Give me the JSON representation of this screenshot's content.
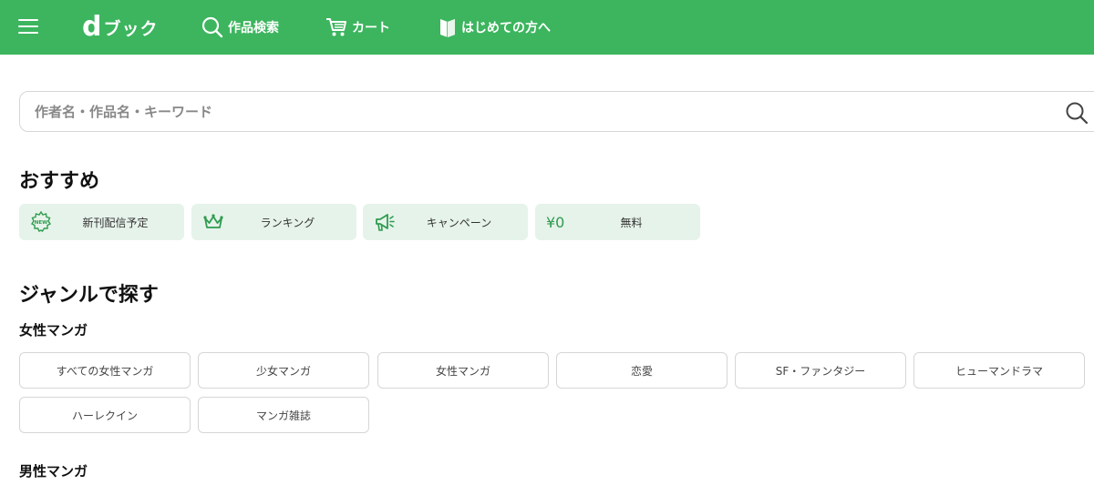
{
  "header": {
    "logo_text": "ブック",
    "logo_mark": "d",
    "nav": [
      {
        "label": "作品検索",
        "icon": "search-icon"
      },
      {
        "label": "カート",
        "icon": "cart-icon"
      },
      {
        "label": "はじめての方へ",
        "icon": "guide-book-icon"
      }
    ]
  },
  "search": {
    "placeholder": "作者名・作品名・キーワード",
    "value": ""
  },
  "recommend": {
    "title": "おすすめ",
    "items": [
      {
        "label": "新刊配信予定",
        "icon": "new-badge-icon",
        "icon_text": "NEW"
      },
      {
        "label": "ランキング",
        "icon": "crown-icon"
      },
      {
        "label": "キャンペーン",
        "icon": "megaphone-icon"
      },
      {
        "label": "無料",
        "icon": "yen-zero-icon",
        "icon_text": "¥0"
      }
    ]
  },
  "genres": {
    "title": "ジャンルで探す",
    "groups": [
      {
        "title": "女性マンガ",
        "items": [
          "すべての女性マンガ",
          "少女マンガ",
          "女性マンガ",
          "恋愛",
          "SF・ファンタジー",
          "ヒューマンドラマ",
          "ハーレクイン",
          "マンガ雑誌"
        ]
      },
      {
        "title": "男性マンガ",
        "items": []
      }
    ]
  },
  "colors": {
    "brand_green": "#3cb55e",
    "tile_bg": "#e6f3ea",
    "icon_green": "#2e9b4e"
  }
}
